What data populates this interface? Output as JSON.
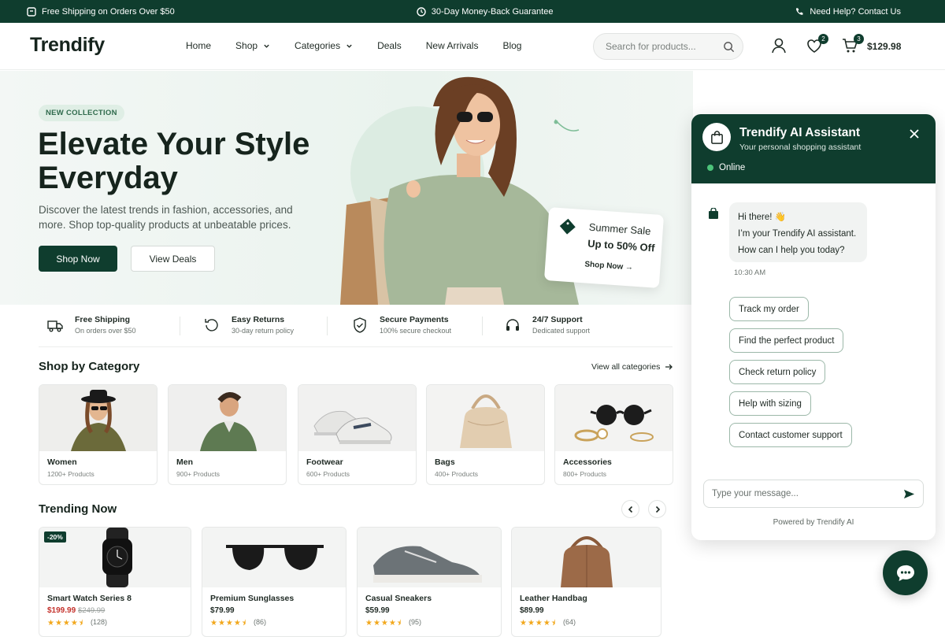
{
  "topbar": {
    "shipping": "Free Shipping on Orders Over $50",
    "guarantee": "30-Day Money-Back Guarantee",
    "help": "Need Help? Contact Us"
  },
  "header": {
    "logo": "Trendify",
    "nav": [
      "Home",
      "Shop",
      "Categories",
      "Deals",
      "New Arrivals",
      "Blog"
    ],
    "search_placeholder": "Search for products...",
    "wishlist_count": "2",
    "cart_count": "3",
    "cart_total": "$129.98"
  },
  "hero": {
    "pill": "NEW COLLECTION",
    "title": "Elevate Your Style Everyday",
    "subtitle": "Discover the latest trends in fashion, accessories, and more. Shop top-quality products at unbeatable prices.",
    "primary_button": "Shop Now",
    "secondary_button": "View Deals",
    "sale_card": {
      "title": "Summer Sale",
      "offer": "Up to 50% Off",
      "link": "Shop Now →"
    }
  },
  "features": [
    {
      "title": "Free Shipping",
      "sub": "On orders over $50",
      "icon": "truck-icon"
    },
    {
      "title": "Easy Returns",
      "sub": "30-day return policy",
      "icon": "return-icon"
    },
    {
      "title": "Secure Payments",
      "sub": "100% secure checkout",
      "icon": "shield-icon"
    },
    {
      "title": "24/7 Support",
      "sub": "Dedicated support",
      "icon": "headset-icon"
    }
  ],
  "categories": {
    "title": "Shop by Category",
    "view_all": "View all categories",
    "items": [
      {
        "name": "Women",
        "count": "1200+ Products"
      },
      {
        "name": "Men",
        "count": "900+ Products"
      },
      {
        "name": "Footwear",
        "count": "600+ Products"
      },
      {
        "name": "Bags",
        "count": "400+ Products"
      },
      {
        "name": "Accessories",
        "count": "800+ Products"
      }
    ]
  },
  "trending": {
    "title": "Trending Now",
    "items": [
      {
        "name": "Smart Watch Series 8",
        "price": "$199.99",
        "old_price": "$249.99",
        "discount": "-20%",
        "rating": 4.5,
        "reviews": "(128)"
      },
      {
        "name": "Premium Sunglasses",
        "price": "$79.99",
        "rating": 4.5,
        "reviews": "(86)"
      },
      {
        "name": "Casual Sneakers",
        "price": "$59.99",
        "rating": 4.5,
        "reviews": "(95)"
      },
      {
        "name": "Leather Handbag",
        "price": "$89.99",
        "rating": 4.5,
        "reviews": "(64)"
      }
    ]
  },
  "chat": {
    "title": "Trendify AI Assistant",
    "subtitle": "Your personal shopping assistant",
    "status": "Online",
    "message": {
      "line1": "Hi there! 👋",
      "line2": "I’m your Trendify AI assistant.",
      "line3": "How can I help you today?",
      "time": "10:30 AM"
    },
    "quick_replies": [
      "Track my order",
      "Find the perfect product",
      "Check return policy",
      "Help with sizing",
      "Contact customer support"
    ],
    "input_placeholder": "Type your message...",
    "powered_by": "Powered by Trendify AI"
  },
  "colors": {
    "brand": "#0f3d2e",
    "accent_light": "#dfeee5",
    "star": "#f2a81d",
    "sale_red": "#c4322c"
  }
}
